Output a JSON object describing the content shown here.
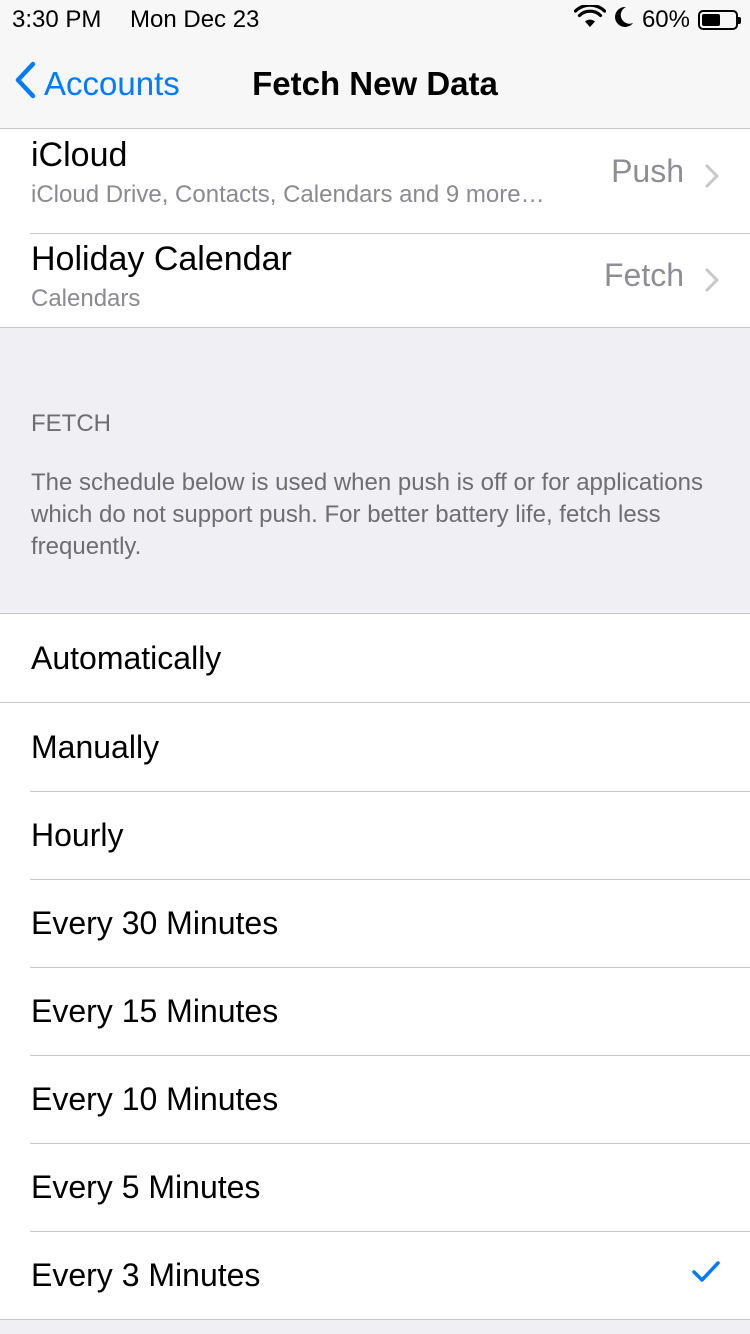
{
  "status_bar": {
    "time": "3:30 PM",
    "date": "Mon Dec 23",
    "battery_percent": "60%",
    "battery_level": 0.6,
    "icons": [
      "wifi-icon",
      "moon-icon",
      "battery-icon"
    ]
  },
  "nav": {
    "back_label": "Accounts",
    "title": "Fetch New Data"
  },
  "accounts": [
    {
      "title": "iCloud",
      "subtitle": "iCloud Drive, Contacts, Calendars and 9 more…",
      "value": "Push"
    },
    {
      "title": "Holiday Calendar",
      "subtitle": "Calendars",
      "value": "Fetch"
    }
  ],
  "fetch": {
    "header": "FETCH",
    "description": "The schedule below is used when push is off or for applications which do not support push. For better battery life, fetch less frequently."
  },
  "automatic": {
    "label": "Automatically"
  },
  "options": [
    {
      "label": "Manually",
      "selected": false
    },
    {
      "label": "Hourly",
      "selected": false
    },
    {
      "label": "Every 30 Minutes",
      "selected": false
    },
    {
      "label": "Every 15 Minutes",
      "selected": false
    },
    {
      "label": "Every 10 Minutes",
      "selected": false
    },
    {
      "label": "Every 5 Minutes",
      "selected": false
    },
    {
      "label": "Every 3 Minutes",
      "selected": true
    }
  ],
  "colors": {
    "accent": "#007aff",
    "background": "#efeff4",
    "secondary_text": "#8e8e93"
  }
}
